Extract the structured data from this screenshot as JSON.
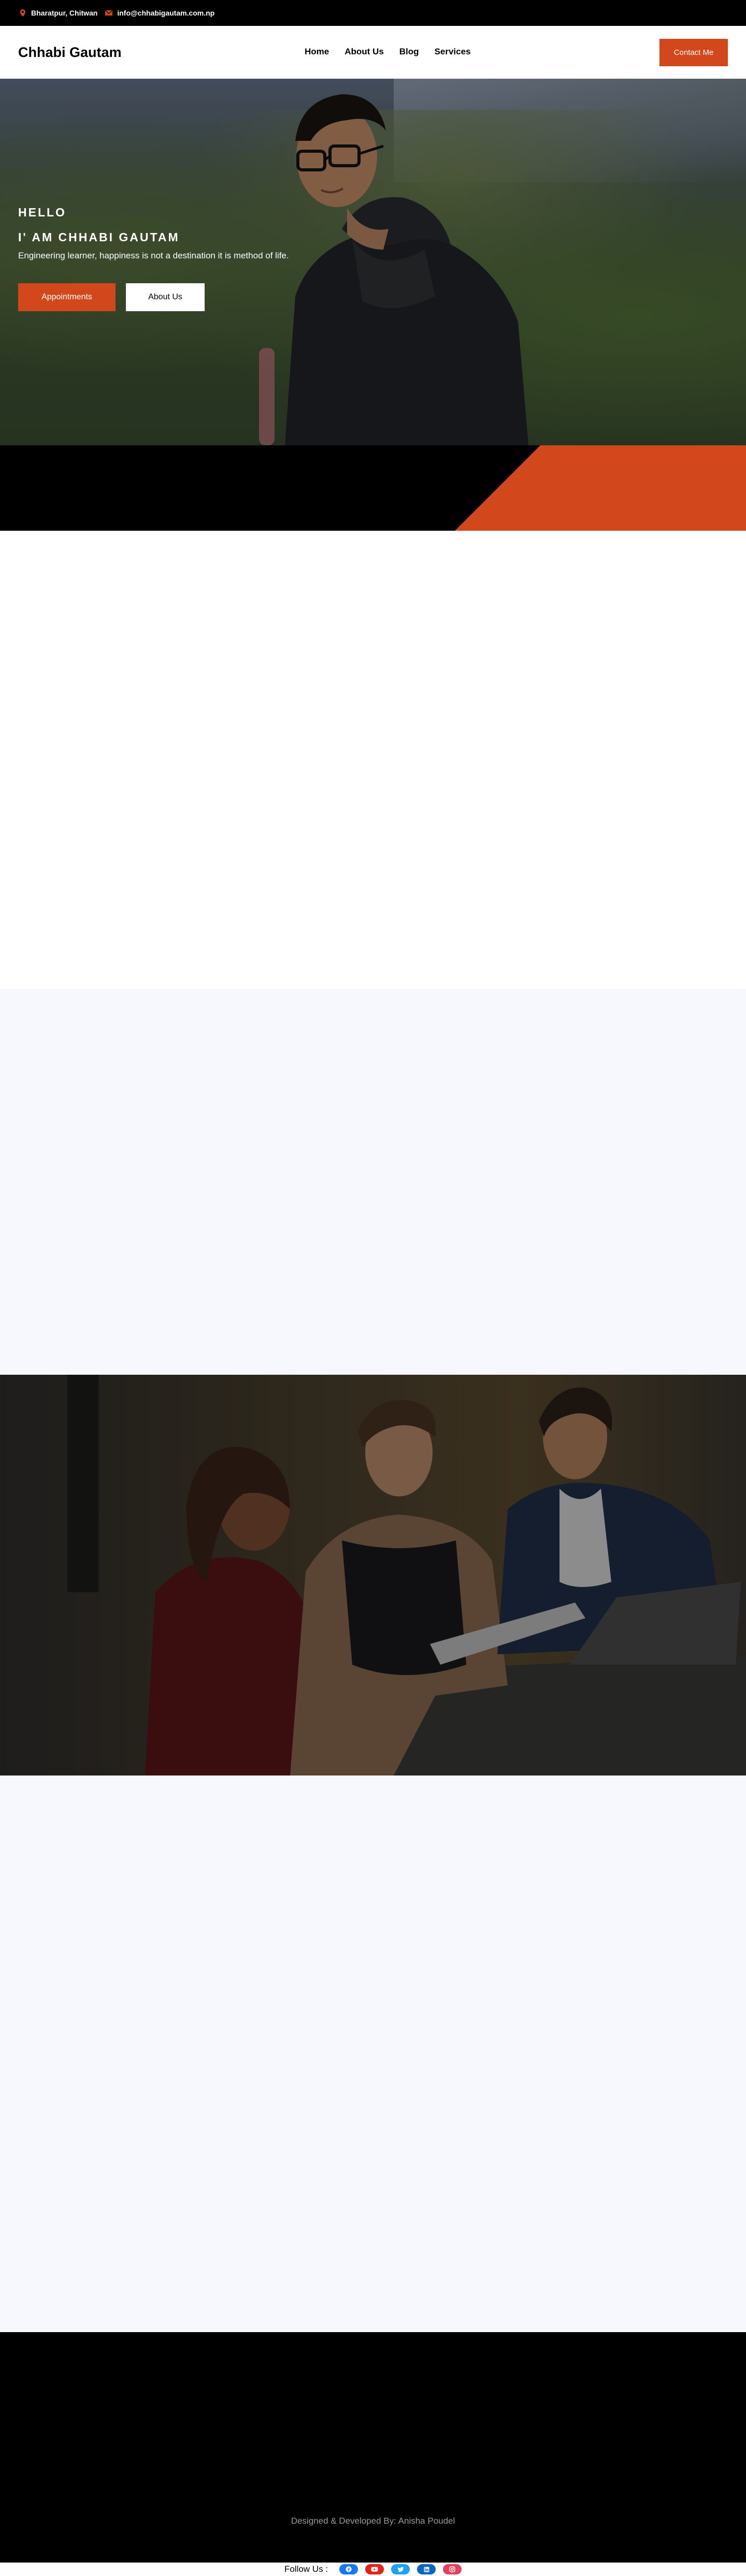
{
  "topbar": {
    "location": "Bharatpur, Chitwan",
    "email": "info@chhabigautam.com.np",
    "location_icon": "map-pin-icon",
    "email_icon": "envelope-icon"
  },
  "header": {
    "brand": "Chhabi Gautam",
    "nav": [
      "Home",
      "About Us",
      "Blog",
      "Services"
    ],
    "contact_button": "Contact Me"
  },
  "hero": {
    "hello": "HELLO",
    "name": "I' AM CHHABI GAUTAM",
    "tagline": "Engineering learner, happiness is not a destination it is method of life.",
    "appointments_button": "Appointments",
    "about_button": "About Us"
  },
  "colors": {
    "accent": "#d2471c",
    "dark": "#000000",
    "light_section": "#f7f8fd"
  },
  "footer": {
    "credit": "Designed & Developed By: Anisha Poudel",
    "follow_label": "Follow Us :",
    "socials": [
      {
        "name": "facebook-icon",
        "color": "#1877f2"
      },
      {
        "name": "youtube-icon",
        "color": "#e62117"
      },
      {
        "name": "twitter-icon",
        "color": "#1da1f2"
      },
      {
        "name": "linkedin-icon",
        "color": "#0a66c2"
      },
      {
        "name": "instagram-icon",
        "color": "#e4405f"
      }
    ]
  }
}
